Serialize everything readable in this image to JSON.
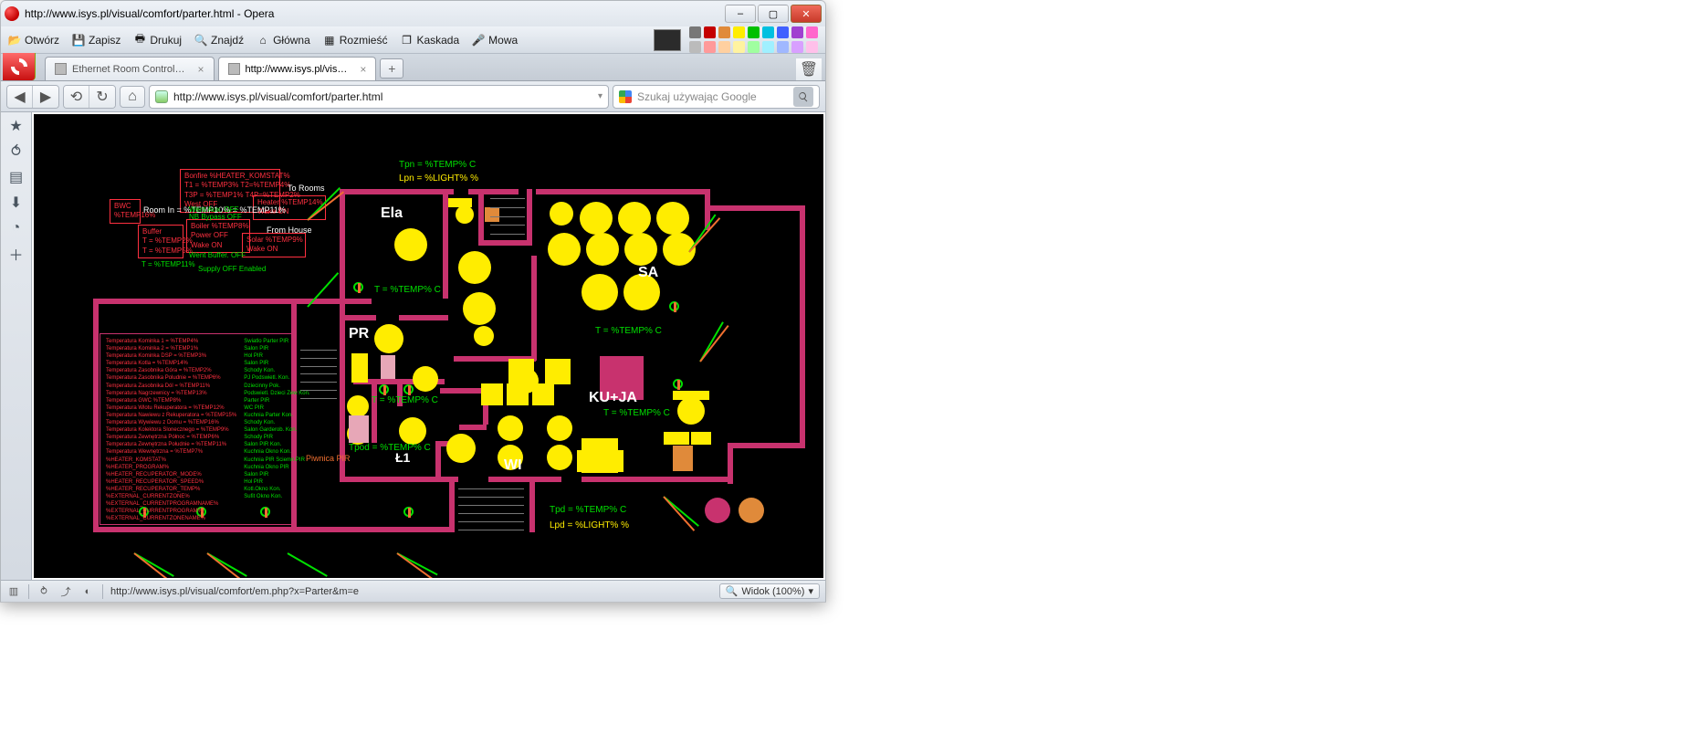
{
  "window": {
    "title": "http://www.isys.pl/visual/comfort/parter.html - Opera",
    "minimize": "–",
    "maximize": "▢",
    "close": "✕"
  },
  "menu": {
    "open": "Otwórz",
    "save": "Zapisz",
    "print": "Drukuj",
    "find": "Znajdź",
    "home": "Główna",
    "tile": "Rozmieść",
    "cascade": "Kaskada",
    "speech": "Mowa"
  },
  "swatches": {
    "big": "#2b2b2b",
    "row1": [
      "#777777",
      "#c40000",
      "#e08a3a",
      "#ffed00",
      "#00c000",
      "#00c0e0",
      "#4060ff",
      "#a040d0",
      "#ff66cc"
    ],
    "row2": [
      "#bbbbbb",
      "#ff9a9a",
      "#ffd0a0",
      "#fff3a0",
      "#a0ffa0",
      "#a0f0ff",
      "#a0b8ff",
      "#d8a0ff",
      "#ffc0ea"
    ]
  },
  "tabs": {
    "t1": "Ethernet Room Control…",
    "t2": "http://www.isys.pl/vis…",
    "new": "+"
  },
  "address": {
    "url": "http://www.isys.pl/visual/comfort/parter.html",
    "drop": "▾",
    "search_placeholder": "Szukaj używając Google"
  },
  "status": {
    "url": "http://www.isys.pl/visual/comfort/em.php?x=Parter&m=e",
    "zoom": "Widok (100%)",
    "drop": "▾"
  },
  "plan": {
    "tpn": "Tpn = %TEMP% C",
    "lpn": "Lpn = %LIGHT% %",
    "tpd": "Tpd = %TEMP% C",
    "lpd": "Lpd = %LIGHT% %",
    "t_generic": "T = %TEMP% C",
    "tpod": "Tpod = %TEMP% C",
    "room_ela": "Ela",
    "room_pr": "PR",
    "room_sa": "SA",
    "room_kuja": "KU+JA",
    "room_wi": "WI",
    "room_l1": "Ł1",
    "piwnica": "Piwnica PIR"
  },
  "heater": {
    "box1a": "Bonfire %HEATER_KOMSTAT%",
    "box1b": "T1 = %TEMP3% T2=%TEMP4%",
    "box1c": "T3P = %TEMP1% T4P=%TEMP2%",
    "box1d": "West OFF",
    "to_rooms": "To Rooms",
    "h14": "Heater %TEMP14%",
    "h14_wake": "Wake ON",
    "boiler": "Boiler %TEMP8%",
    "b_power": "Power OFF",
    "b_wake": "Wake ON",
    "solar": "Solar %TEMP9%",
    "s_wake": "Wake ON",
    "bwc": "BWC",
    "bwc_t": "%TEMP16%",
    "room_in": "Room In = %TEMP10% = %TEMP11%",
    "buffer": "Buffer",
    "buf_t1": "T = %TEMP2%",
    "buf_t2": "T = %TEMP5%",
    "went_aux": "Went Aux. OFF",
    "nb_bypass": "NB Bypass OFF",
    "went_buffer": "Went Buffer. OFF",
    "supply": "Supply OFF Enabled",
    "from_house": "From House",
    "t_tmp11": "T = %TEMP11%"
  },
  "info_left": [
    "Temperatura Kominka 1 = %TEMP4%",
    "Temperatura Kominka 2 = %TEMP1%",
    "Temperatura Kominka DSP = %TEMP3%",
    "Temperatura Kotla = %TEMP14%",
    "Temperatura Zasobnika Góra = %TEMP2%",
    "Temperatura Zasobnika Poludnie = %TEMP6%",
    "Temperatura Zasobnika Dól = %TEMP11%",
    "Temperatura Nagrzewnicy = %TEMP13%",
    "Temperatura GWC %TEMP8%",
    "Temperatura Wlotu Rekuperatora = %TEMP12%",
    "Temperatura Nawiewu z Rekuperatora = %TEMP15%",
    "Temperatura Wywiewu z Domu = %TEMP16%",
    "Temperatura Kolektora Slonecznego = %TEMP9%",
    "Temperatura Zewnętrzna Północ = %TEMP6%",
    "Temperatura Zewnętrzna Południe = %TEMP11%",
    "Temperatura Wewnętrzna = %TEMP7%",
    "%HEATER_KOMSTAT%",
    "%HEATER_PROGRAM%",
    "%HEATER_RECUPERATOR_MODE%",
    "%HEATER_RECUPERATOR_SPEED%",
    "%HEATER_RECUPERATOR_TEMP%",
    "%EXTERNAL_CURRENTZONE%",
    "%EXTERNAL_CURRENTPROGRAMNAME%",
    "%EXTERNAL_CURRENTPROGRAM%",
    "%EXTERNAL_CURRENTZONENAME%"
  ],
  "info_right": [
    "Swiatlo Parter PIR",
    "Salon PIR",
    "Hol PIR",
    "Salon PIR",
    "Schody Kon.",
    "PJ Podswietl. Kon.",
    "Dziecinny Pok.",
    "Podswietl. Dzieci Zew Kon.",
    "Parter PIR",
    "WC PIR",
    "Kuchnia Parter Kon.",
    "Schody Kon.",
    "Salon Garderob. Kon.",
    "Schody PIR",
    "Salon PIR Kon.",
    "Kuchnia Okno Kon.",
    "Kuchnia PIR Sciemn.PIR",
    "Kuchnia Okno PIR",
    "Salon PIR",
    "Hol PIR",
    "Kotl.Okno Kon.",
    "Sufit Okno Kon."
  ]
}
